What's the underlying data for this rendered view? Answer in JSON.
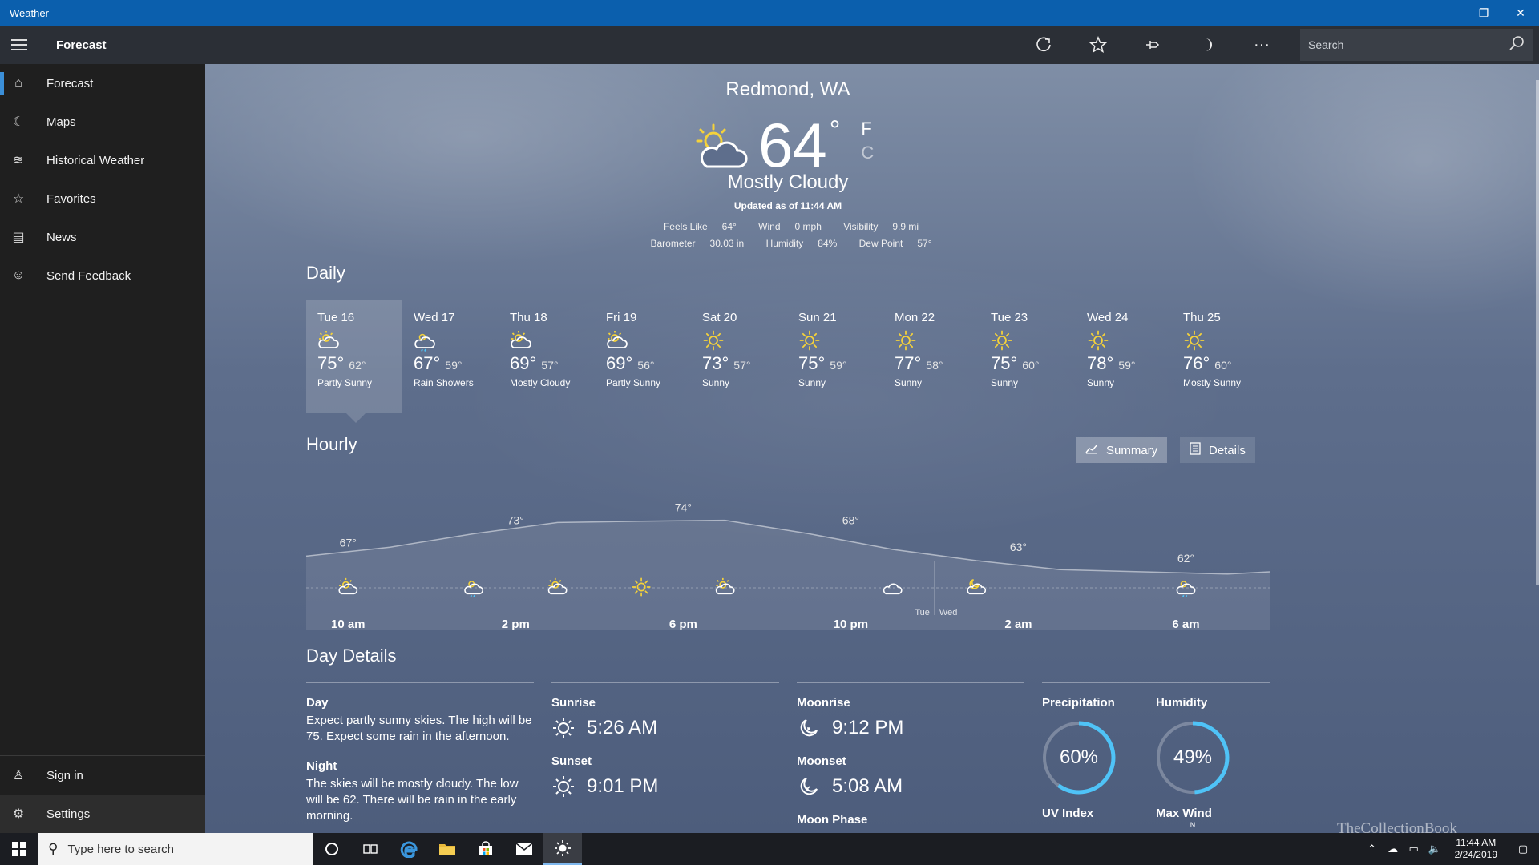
{
  "window": {
    "title": "Weather",
    "minimize": "—",
    "restore": "❐",
    "close": "✕"
  },
  "cmdbar": {
    "title": "Forecast",
    "search_placeholder": "Search",
    "more": "···"
  },
  "sidebar": {
    "items": [
      {
        "label": "Forecast",
        "icon": "⌂"
      },
      {
        "label": "Maps",
        "icon": "☾"
      },
      {
        "label": "Historical Weather",
        "icon": "≋"
      },
      {
        "label": "Favorites",
        "icon": "☆"
      },
      {
        "label": "News",
        "icon": "▤"
      },
      {
        "label": "Send Feedback",
        "icon": "☺"
      }
    ],
    "bottom": [
      {
        "label": "Sign in",
        "icon": "♙"
      },
      {
        "label": "Settings",
        "icon": "⚙"
      }
    ]
  },
  "current": {
    "location": "Redmond, WA",
    "temp": "64",
    "deg": "°",
    "unit_f": "F",
    "unit_c": "C",
    "condition": "Mostly Cloudy",
    "updated": "Updated as of 11:44 AM",
    "feels_like_label": "Feels Like",
    "feels_like": "64°",
    "wind_label": "Wind",
    "wind": "0 mph",
    "visibility_label": "Visibility",
    "visibility": "9.9 mi",
    "barometer_label": "Barometer",
    "barometer": "30.03 in",
    "humidity_label": "Humidity",
    "humidity": "84%",
    "dewpoint_label": "Dew Point",
    "dewpoint": "57°"
  },
  "daily": {
    "heading": "Daily",
    "days": [
      {
        "name": "Tue 16",
        "hi": "75°",
        "lo": "62°",
        "cond": "Partly Sunny",
        "icon": "partly-sunny"
      },
      {
        "name": "Wed 17",
        "hi": "67°",
        "lo": "59°",
        "cond": "Rain Showers",
        "icon": "rain-showers"
      },
      {
        "name": "Thu 18",
        "hi": "69°",
        "lo": "57°",
        "cond": "Mostly Cloudy",
        "icon": "partly-sunny"
      },
      {
        "name": "Fri 19",
        "hi": "69°",
        "lo": "56°",
        "cond": "Partly Sunny",
        "icon": "partly-sunny"
      },
      {
        "name": "Sat 20",
        "hi": "73°",
        "lo": "57°",
        "cond": "Sunny",
        "icon": "sunny"
      },
      {
        "name": "Sun 21",
        "hi": "75°",
        "lo": "59°",
        "cond": "Sunny",
        "icon": "sunny"
      },
      {
        "name": "Mon 22",
        "hi": "77°",
        "lo": "58°",
        "cond": "Sunny",
        "icon": "sunny"
      },
      {
        "name": "Tue 23",
        "hi": "75°",
        "lo": "60°",
        "cond": "Sunny",
        "icon": "sunny"
      },
      {
        "name": "Wed 24",
        "hi": "78°",
        "lo": "59°",
        "cond": "Sunny",
        "icon": "sunny"
      },
      {
        "name": "Thu 25",
        "hi": "76°",
        "lo": "60°",
        "cond": "Mostly Sunny",
        "icon": "sunny"
      }
    ]
  },
  "hourly": {
    "heading": "Hourly",
    "summary_label": "Summary",
    "details_label": "Details",
    "day_split_left": "Tue",
    "day_split_right": "Wed",
    "time_labels": [
      "10 am",
      "2 pm",
      "6 pm",
      "10 pm",
      "2 am",
      "6 am"
    ],
    "temp_labels": [
      {
        "text": "67°",
        "hour": 10
      },
      {
        "text": "73°",
        "hour": 14
      },
      {
        "text": "74°",
        "hour": 18
      },
      {
        "text": "68°",
        "hour": 22
      },
      {
        "text": "63°",
        "hour": 26
      },
      {
        "text": "62°",
        "hour": 30
      }
    ],
    "curve": [
      {
        "hour": 9,
        "temp": 66
      },
      {
        "hour": 11,
        "temp": 68
      },
      {
        "hour": 13,
        "temp": 71
      },
      {
        "hour": 15,
        "temp": 73.5
      },
      {
        "hour": 17,
        "temp": 73.8
      },
      {
        "hour": 19,
        "temp": 74
      },
      {
        "hour": 21,
        "temp": 71
      },
      {
        "hour": 23,
        "temp": 67.5
      },
      {
        "hour": 25,
        "temp": 65
      },
      {
        "hour": 27,
        "temp": 63
      },
      {
        "hour": 29,
        "temp": 62.5
      },
      {
        "hour": 31,
        "temp": 62
      },
      {
        "hour": 32,
        "temp": 62.5
      }
    ],
    "icons": [
      {
        "hour": 10,
        "icon": "partly-sunny"
      },
      {
        "hour": 13,
        "icon": "rain-showers"
      },
      {
        "hour": 15,
        "icon": "partly-sunny"
      },
      {
        "hour": 17,
        "icon": "sunny"
      },
      {
        "hour": 19,
        "icon": "partly-sunny"
      },
      {
        "hour": 23,
        "icon": "cloudy"
      },
      {
        "hour": 25,
        "icon": "partly-night"
      },
      {
        "hour": 30,
        "icon": "rain-showers"
      }
    ]
  },
  "day_details": {
    "heading": "Day Details",
    "day_label": "Day",
    "day_text": "Expect partly sunny skies. The high will be 75. Expect some rain in the afternoon.",
    "night_label": "Night",
    "night_text": "The skies will be mostly cloudy. The low will be 62. There will be rain in the early morning.",
    "sunrise_label": "Sunrise",
    "sunrise": "5:26 AM",
    "sunset_label": "Sunset",
    "sunset": "9:01 PM",
    "moonrise_label": "Moonrise",
    "moonrise": "9:12 PM",
    "moonset_label": "Moonset",
    "moonset": "5:08 AM",
    "moonphase_label": "Moon Phase",
    "precip_label": "Precipitation",
    "precip": "60%",
    "precip_value": 60,
    "humidity_label": "Humidity",
    "humidity": "49%",
    "humidity_value": 49,
    "uv_label": "UV Index",
    "maxwind_label": "Max Wind",
    "maxwind_dir": "N"
  },
  "taskbar": {
    "search_placeholder": "Type here to search",
    "time": "11:44 AM",
    "date": "2/24/2019",
    "watermark": "TheCollectionBook"
  },
  "colors": {
    "accent": "#0b5fad",
    "ring": "#4fc3f7",
    "sun": "#f5d23a"
  }
}
